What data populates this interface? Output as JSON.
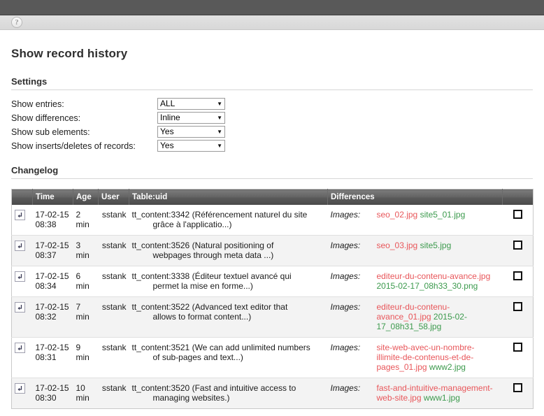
{
  "toolbar": {
    "help_icon": "help-icon",
    "help_glyph": "?"
  },
  "page": {
    "title": "Show record history",
    "settings_heading": "Settings",
    "changelog_heading": "Changelog"
  },
  "settings": {
    "rows": [
      {
        "label": "Show entries:",
        "value": "ALL",
        "caret": "▼"
      },
      {
        "label": "Show differences:",
        "value": "Inline",
        "caret": "▼"
      },
      {
        "label": "Show sub elements:",
        "value": "Yes",
        "caret": "▼"
      },
      {
        "label": "Show inserts/deletes of records:",
        "value": "Yes",
        "caret": "▼"
      }
    ]
  },
  "changelog": {
    "columns": {
      "icon": "",
      "time": "Time",
      "age": "Age",
      "user": "User",
      "table": "Table:uid",
      "differences": "Differences",
      "check": ""
    },
    "rows": [
      {
        "time_date": "17-02-15",
        "time_clock": "08:38",
        "age": "2 min",
        "user": "sstank",
        "table_line1": "tt_content:3342 (Référencement naturel du site",
        "table_line2": "grâce à l'applicatio...)",
        "diff_field": "Images:",
        "diff_deleted": "seo_02.jpg",
        "diff_inserted": "site5_01.jpg"
      },
      {
        "time_date": "17-02-15",
        "time_clock": "08:37",
        "age": "3 min",
        "user": "sstank",
        "table_line1": "tt_content:3526 (Natural positioning of",
        "table_line2": "webpages through meta data ...)",
        "diff_field": "Images:",
        "diff_deleted": "seo_03.jpg",
        "diff_inserted": "site5.jpg"
      },
      {
        "time_date": "17-02-15",
        "time_clock": "08:34",
        "age": "6 min",
        "user": "sstank",
        "table_line1": "tt_content:3338 (Éditeur textuel avancé qui",
        "table_line2": "permet la mise en forme...)",
        "diff_field": "Images:",
        "diff_deleted": "editeur-du-contenu-avance.jpg",
        "diff_inserted": "2015-02-17_08h33_30.png"
      },
      {
        "time_date": "17-02-15",
        "time_clock": "08:32",
        "age": "7 min",
        "user": "sstank",
        "table_line1": "tt_content:3522 (Advanced text editor that",
        "table_line2": "allows to format content...)",
        "diff_field": "Images:",
        "diff_deleted": "editeur-du-contenu-avance_01.jpg",
        "diff_inserted": "2015-02-17_08h31_58.jpg"
      },
      {
        "time_date": "17-02-15",
        "time_clock": "08:31",
        "age": "9 min",
        "user": "sstank",
        "table_line1": "tt_content:3521 (We can add unlimited numbers",
        "table_line2": "of sub-pages and text...)",
        "diff_field": "Images:",
        "diff_deleted": "site-web-avec-un-nombre-illimite-de-contenus-et-de-pages_01.jpg",
        "diff_inserted": "www2.jpg"
      },
      {
        "time_date": "17-02-15",
        "time_clock": "08:30",
        "age": "10 min",
        "user": "sstank",
        "table_line1": "tt_content:3520 (Fast and intuitive access to",
        "table_line2": "managing websites.)",
        "diff_field": "Images:",
        "diff_deleted": "fast-and-intuitive-management-web-site.jpg",
        "diff_inserted": "www1.jpg"
      }
    ]
  },
  "colors": {
    "deleted": "#e8565a",
    "inserted": "#3c9a4d",
    "topbar": "#595959",
    "header_row": "#5a5a5a"
  }
}
